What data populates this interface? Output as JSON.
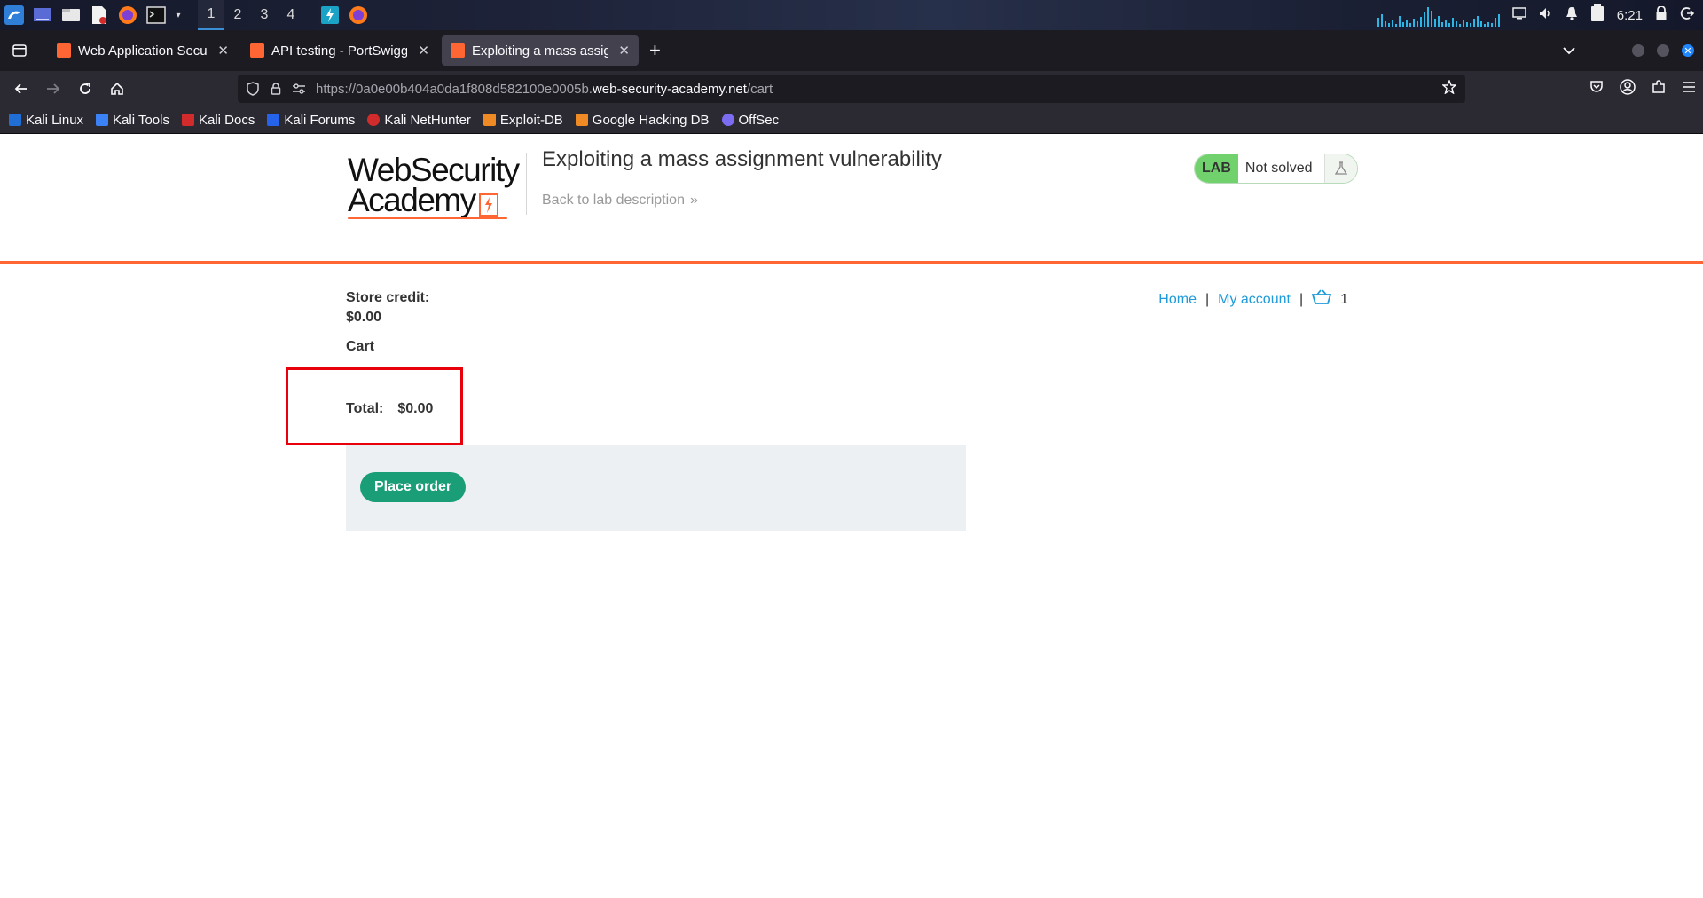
{
  "taskbar": {
    "workspaces": [
      "1",
      "2",
      "3",
      "4"
    ],
    "active_workspace": "1",
    "clock": "6:21"
  },
  "browser": {
    "tabs": [
      {
        "title": "Web Application Security",
        "active": false
      },
      {
        "title": "API testing - PortSwigger",
        "active": false
      },
      {
        "title": "Exploiting a mass assignm",
        "active": true
      }
    ],
    "new_tab": "+",
    "url_prefix": "https://0a0e00b404a0da1f808d582100e0005b.",
    "url_domain": "web-security-academy.net",
    "url_path": "/cart",
    "bookmarks": [
      {
        "label": "Kali Linux",
        "color": "#1f6fd6"
      },
      {
        "label": "Kali Tools",
        "color": "#3b82f6"
      },
      {
        "label": "Kali Docs",
        "color": "#d22b2b"
      },
      {
        "label": "Kali Forums",
        "color": "#2563eb"
      },
      {
        "label": "Kali NetHunter",
        "color": "#d22b2b"
      },
      {
        "label": "Exploit-DB",
        "color": "#f08a24"
      },
      {
        "label": "Google Hacking DB",
        "color": "#f08a24"
      },
      {
        "label": "OffSec",
        "color": "#7c6cf2"
      }
    ]
  },
  "lab": {
    "logo_line1": "WebSecurity",
    "logo_line2": "Academy",
    "title": "Exploiting a mass assignment vulnerability",
    "back_link": "Back to lab description",
    "badge": "LAB",
    "status": "Not solved",
    "accent": "#ff6633"
  },
  "nav": {
    "home": "Home",
    "account": "My account",
    "separator": "|",
    "cart_count": "1"
  },
  "store": {
    "credit_label": "Store credit:",
    "credit_value": "$0.00",
    "cart_heading": "Cart",
    "total_label": "Total:",
    "total_value": "$0.00",
    "place_order": "Place order"
  }
}
